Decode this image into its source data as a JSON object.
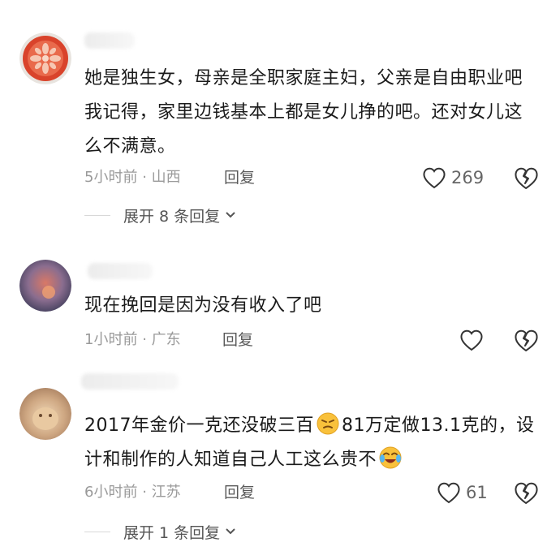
{
  "comments": [
    {
      "text": "她是独生女，母亲是全职家庭主妇，父亲是自由职业吧我记得，家里边钱基本上都是女儿挣的吧。还对女儿这么不满意。",
      "time": "5小时前",
      "dot": "·",
      "region": "山西",
      "reply_label": "回复",
      "likes": "269",
      "expand_label": "展开 8 条回复"
    },
    {
      "text": "现在挽回是因为没有收入了吧",
      "time": "1小时前",
      "dot": "·",
      "region": "广东",
      "reply_label": "回复",
      "likes": "",
      "expand_label": ""
    },
    {
      "text_part1": "2017年金价一克还没破三百",
      "text_part2": "81万定做13.1克的，设计和制作的人知道自己人工这么贵不",
      "emoji1": "smirk-face-icon",
      "emoji2": "laughing-tears-face-icon",
      "time": "6小时前",
      "dot": "·",
      "region": "江苏",
      "reply_label": "回复",
      "likes": "61",
      "expand_label": "展开 1 条回复"
    }
  ],
  "icons": {
    "like": "heart-outline-icon",
    "dislike": "broken-heart-icon",
    "expand": "chevron-down-icon"
  },
  "colors": {
    "text": "#1b1b1b",
    "meta": "#9a9a9a",
    "reply": "#5a5a5a"
  }
}
